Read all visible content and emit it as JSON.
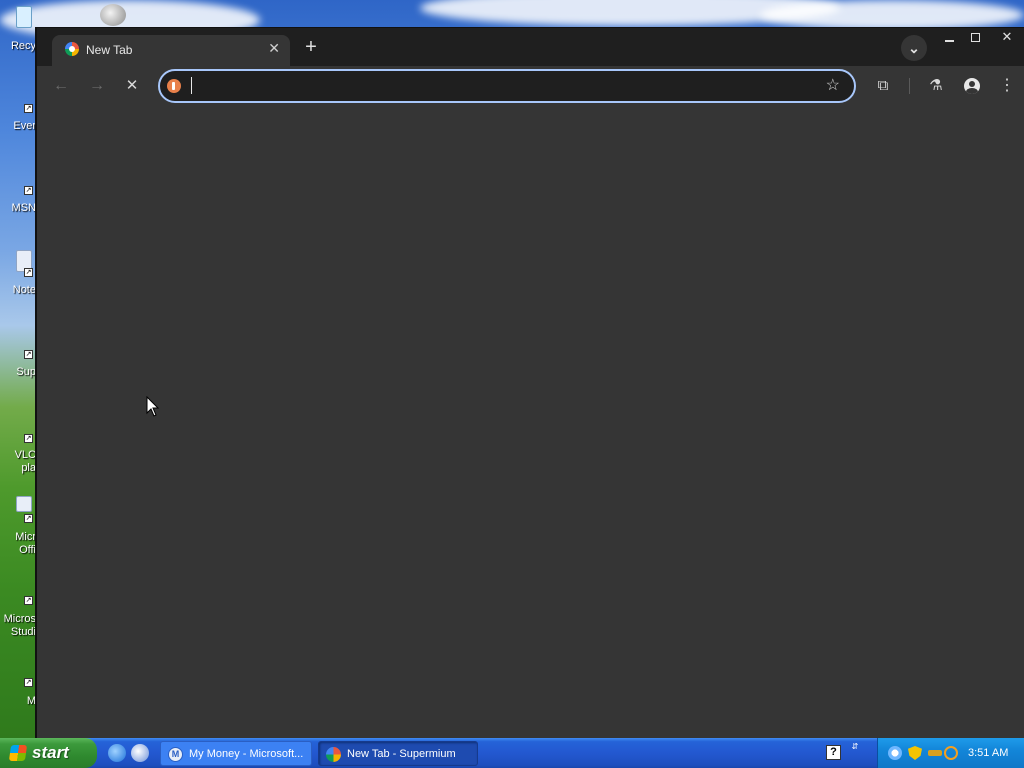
{
  "desktop": {
    "icons": [
      {
        "label": "Recy",
        "top": 0
      },
      {
        "label": "Ever",
        "top": 0
      },
      {
        "label": "MSN",
        "top": 0
      },
      {
        "label": "Note",
        "top": 0
      },
      {
        "label": "Sup",
        "top": 0
      },
      {
        "label": "VLC",
        "top": 0
      },
      {
        "label": "pla",
        "top": 0
      },
      {
        "label": "Micr",
        "top": 0
      },
      {
        "label": "Offi",
        "top": 0
      },
      {
        "label": "Micros",
        "top": 0
      },
      {
        "label": "Studi",
        "top": 0
      },
      {
        "label": "M",
        "top": 0
      }
    ]
  },
  "browser": {
    "tab": {
      "title": "New Tab",
      "close": "✕"
    },
    "new_tab": "+",
    "tab_search": "⌄",
    "window_controls": {
      "close": "✕"
    },
    "toolbar": {
      "back": "←",
      "forward": "→",
      "stop": "✕",
      "omnibox_value": "",
      "omnibox_placeholder": "",
      "bookmark_star": "☆",
      "extensions": "⧉",
      "labs": "⚗",
      "menu": "⋮"
    },
    "colors": {
      "frame": "#1f1f1f",
      "toolbar": "#353535",
      "focus_ring": "#a8c7fa"
    }
  },
  "taskbar": {
    "start_label": "start",
    "tasks": [
      {
        "label": "My Money - Microsoft...",
        "icon": "M"
      },
      {
        "label": "New Tab - Supermium",
        "icon": ""
      }
    ],
    "help": "?",
    "lang": "⇵",
    "clock": "3:51 AM"
  }
}
